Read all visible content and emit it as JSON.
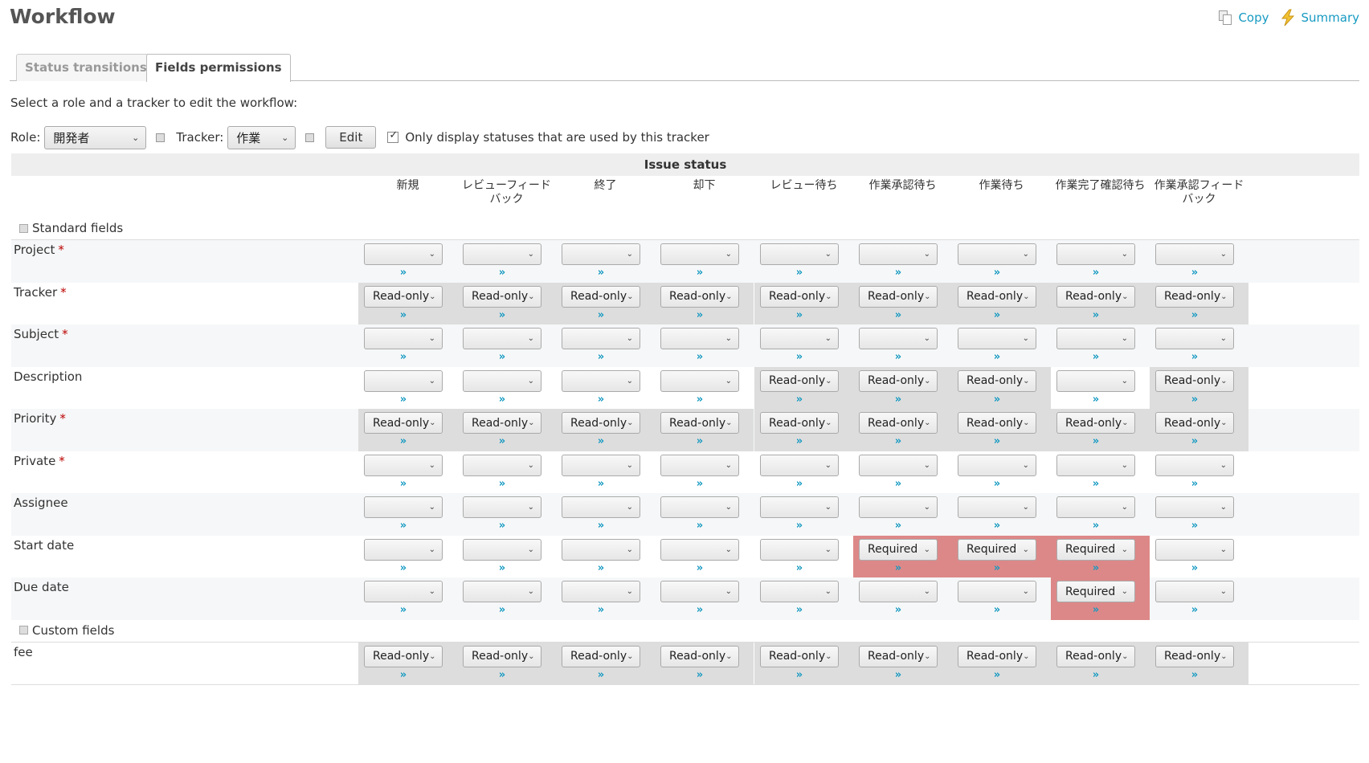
{
  "page": {
    "title": "Workflow",
    "actions": [
      {
        "label": "Copy",
        "icon": "copy-icon"
      },
      {
        "label": "Summary",
        "icon": "lightning-icon"
      }
    ]
  },
  "tabs": [
    {
      "label": "Status transitions",
      "active": false
    },
    {
      "label": "Fields permissions",
      "active": true
    }
  ],
  "instruction": "Select a role and a tracker to edit the workflow:",
  "filters": {
    "role_label": "Role:",
    "role_value": "開発者",
    "tracker_label": "Tracker:",
    "tracker_value": "作業",
    "edit_button": "Edit",
    "only_used_label": "Only display statuses that are used by this tracker",
    "only_used_checked": true
  },
  "table": {
    "status_header": "Issue status",
    "statuses": [
      "新規",
      "レビューフィードバック",
      "終了",
      "却下",
      "レビュー待ち",
      "作業承認待ち",
      "作業待ち",
      "作業完了確認待ち",
      "作業承認フィードバック"
    ],
    "apply_link": "»",
    "sections": [
      {
        "title": "Standard fields",
        "fields": [
          {
            "name": "Project",
            "required": true,
            "cells": [
              "",
              "",
              "",
              "",
              "",
              "",
              "",
              "",
              ""
            ]
          },
          {
            "name": "Tracker",
            "required": true,
            "cells": [
              "Read-only",
              "Read-only",
              "Read-only",
              "Read-only",
              "Read-only",
              "Read-only",
              "Read-only",
              "Read-only",
              "Read-only"
            ]
          },
          {
            "name": "Subject",
            "required": true,
            "cells": [
              "",
              "",
              "",
              "",
              "",
              "",
              "",
              "",
              ""
            ]
          },
          {
            "name": "Description",
            "required": false,
            "cells": [
              "",
              "",
              "",
              "",
              "Read-only",
              "Read-only",
              "Read-only",
              "",
              "Read-only"
            ]
          },
          {
            "name": "Priority",
            "required": true,
            "cells": [
              "Read-only",
              "Read-only",
              "Read-only",
              "Read-only",
              "Read-only",
              "Read-only",
              "Read-only",
              "Read-only",
              "Read-only"
            ]
          },
          {
            "name": "Private",
            "required": true,
            "cells": [
              "",
              "",
              "",
              "",
              "",
              "",
              "",
              "",
              ""
            ]
          },
          {
            "name": "Assignee",
            "required": false,
            "cells": [
              "",
              "",
              "",
              "",
              "",
              "",
              "",
              "",
              ""
            ]
          },
          {
            "name": "Start date",
            "required": false,
            "cells": [
              "",
              "",
              "",
              "",
              "",
              "Required",
              "Required",
              "Required",
              ""
            ]
          },
          {
            "name": "Due date",
            "required": false,
            "cells": [
              "",
              "",
              "",
              "",
              "",
              "",
              "",
              "Required",
              ""
            ]
          }
        ]
      },
      {
        "title": "Custom fields",
        "fields": [
          {
            "name": "fee",
            "required": false,
            "cells": [
              "Read-only",
              "Read-only",
              "Read-only",
              "Read-only",
              "Read-only",
              "Read-only",
              "Read-only",
              "Read-only",
              "Read-only"
            ]
          }
        ]
      }
    ]
  },
  "colors": {
    "readonly_bg": "#dddddd",
    "required_bg": "#dd8888",
    "link": "#169ac2",
    "required_star": "#bb0000"
  }
}
